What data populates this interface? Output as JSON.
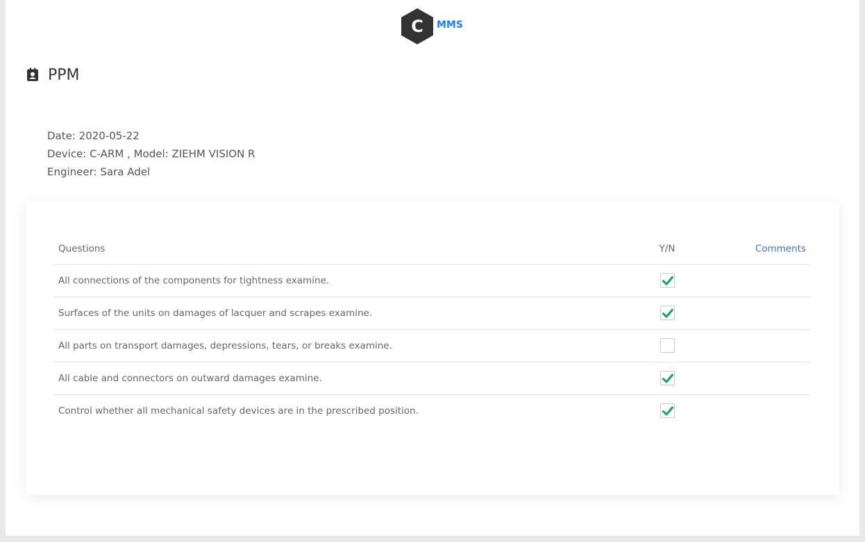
{
  "logo": {
    "letter": "C",
    "text": "MMS",
    "color": "#1e7ee6"
  },
  "page": {
    "title": "PPM",
    "icon": "contact-card-icon"
  },
  "meta": {
    "date": "Date: 2020-05-22",
    "device": "Device: C-ARM , Model: ZIEHM VISION R",
    "engineer": "Engineer: Sara Adel"
  },
  "table": {
    "headers": {
      "questions": "Questions",
      "yn": "Y/N",
      "comments": "Comments"
    },
    "rows": [
      {
        "question": "All connections of the components for tightness examine.",
        "checked": true,
        "comment": ""
      },
      {
        "question": "Surfaces of the units on damages of lacquer and scrapes examine.",
        "checked": true,
        "comment": ""
      },
      {
        "question": "All parts on transport damages, depressions, tears, or breaks examine.",
        "checked": false,
        "comment": ""
      },
      {
        "question": "All cable and connectors on outward damages examine.",
        "checked": true,
        "comment": ""
      },
      {
        "question": "Control whether all mechanical safety devices are in the prescribed position.",
        "checked": true,
        "comment": ""
      }
    ]
  },
  "colors": {
    "check": "#1aa05a",
    "link": "#4a6fc1",
    "hexagon": "#333333"
  }
}
